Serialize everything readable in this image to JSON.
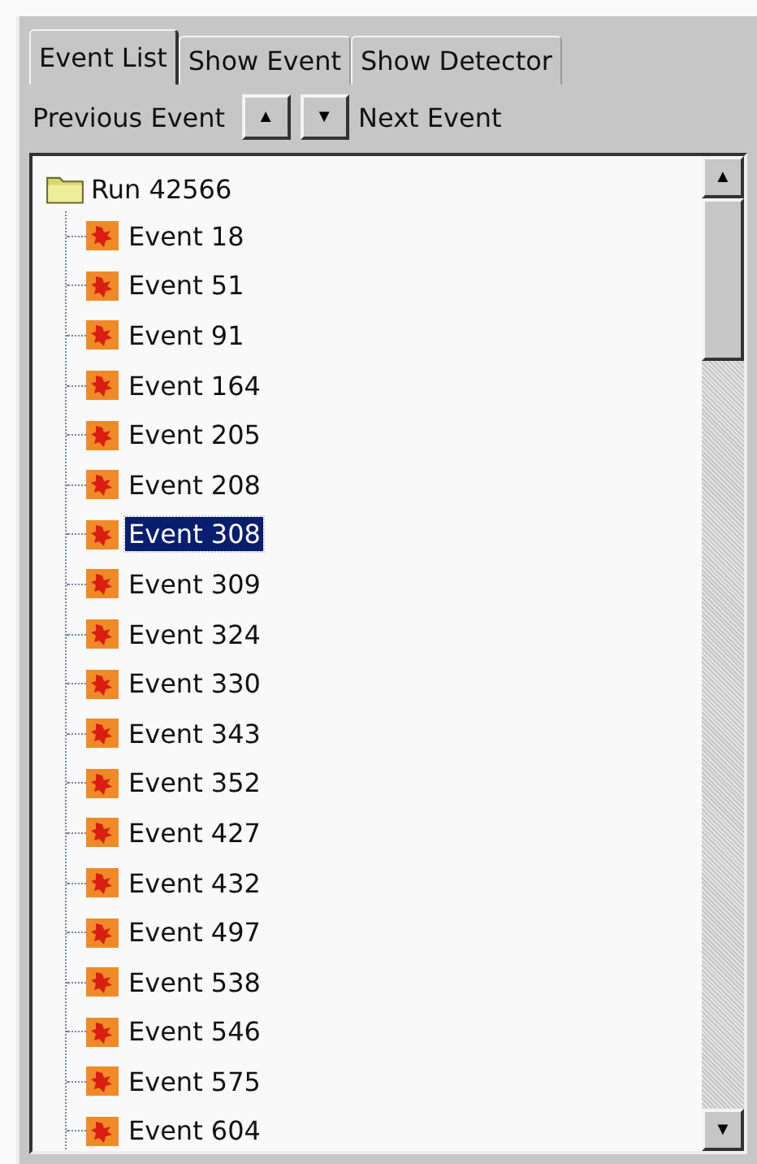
{
  "tabs": [
    {
      "label": "Event List",
      "selected": true
    },
    {
      "label": "Show Event",
      "selected": false
    },
    {
      "label": "Show Detector",
      "selected": false
    }
  ],
  "navigation": {
    "previous_label": "Previous Event",
    "up_button": "▲",
    "down_button": "▼",
    "next_label": "Next Event"
  },
  "tree": {
    "root": {
      "label": "Run 42566",
      "expanded": true,
      "children": [
        {
          "label": "Event 18",
          "selected": false
        },
        {
          "label": "Event 51",
          "selected": false
        },
        {
          "label": "Event 91",
          "selected": false
        },
        {
          "label": "Event 164",
          "selected": false
        },
        {
          "label": "Event 205",
          "selected": false
        },
        {
          "label": "Event 208",
          "selected": false
        },
        {
          "label": "Event 308",
          "selected": true
        },
        {
          "label": "Event 309",
          "selected": false
        },
        {
          "label": "Event 324",
          "selected": false
        },
        {
          "label": "Event 330",
          "selected": false
        },
        {
          "label": "Event 343",
          "selected": false
        },
        {
          "label": "Event 352",
          "selected": false
        },
        {
          "label": "Event 427",
          "selected": false
        },
        {
          "label": "Event 432",
          "selected": false
        },
        {
          "label": "Event 497",
          "selected": false
        },
        {
          "label": "Event 538",
          "selected": false
        },
        {
          "label": "Event 546",
          "selected": false
        },
        {
          "label": "Event 575",
          "selected": false
        },
        {
          "label": "Event 604",
          "selected": false
        }
      ]
    }
  },
  "scrollbar": {
    "up_arrow": "▲",
    "down_arrow": "▼"
  }
}
